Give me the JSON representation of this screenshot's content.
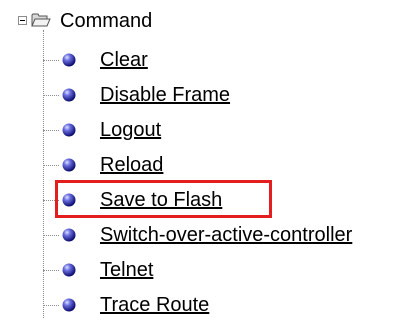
{
  "tree": {
    "root": {
      "label": "Command",
      "expander_icon": "collapse-minus-icon",
      "icon": "open-folder-icon",
      "expanded": true
    },
    "items": [
      {
        "label": "Clear",
        "icon": "blue-sphere-bullet-icon"
      },
      {
        "label": "Disable Frame",
        "icon": "blue-sphere-bullet-icon"
      },
      {
        "label": "Logout",
        "icon": "blue-sphere-bullet-icon"
      },
      {
        "label": "Reload",
        "icon": "blue-sphere-bullet-icon"
      },
      {
        "label": "Save to Flash",
        "icon": "blue-sphere-bullet-icon",
        "highlighted": true
      },
      {
        "label": "Switch-over-active-controller",
        "icon": "blue-sphere-bullet-icon"
      },
      {
        "label": "Telnet",
        "icon": "blue-sphere-bullet-icon"
      },
      {
        "label": "Trace Route",
        "icon": "blue-sphere-bullet-icon"
      }
    ]
  },
  "colors": {
    "highlight_border": "#e41e1e",
    "bullet_blue": "#1a1a8c",
    "tree_lines": "#8c8c8c",
    "link_text": "#000000"
  }
}
